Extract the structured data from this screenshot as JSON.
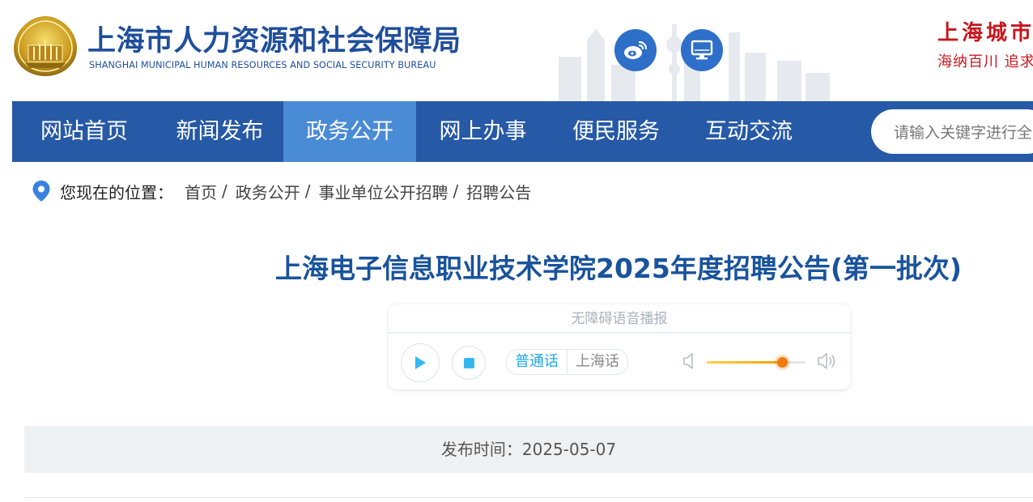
{
  "header": {
    "title": "上海市人力资源和社会保障局",
    "subtitle": "SHANGHAI MUNICIPAL HUMAN RESOURCES AND SOCIAL SECURITY BUREAU",
    "slogan_line1": "上海城市",
    "slogan_line2": "海纳百川 追求",
    "icons": [
      "emblem-logo",
      "weibo-icon",
      "desktop-icon"
    ]
  },
  "nav": {
    "items": [
      {
        "label": "网站首页"
      },
      {
        "label": "新闻发布"
      },
      {
        "label": "政务公开",
        "active": true
      },
      {
        "label": "网上办事"
      },
      {
        "label": "便民服务"
      },
      {
        "label": "互动交流"
      }
    ],
    "search_placeholder": "请输入关键字进行全"
  },
  "breadcrumb": {
    "label": "您现在的位置：",
    "items": [
      "首页",
      "政务公开",
      "事业单位公开招聘",
      "招聘公告"
    ],
    "separator": "/"
  },
  "article": {
    "title": "上海电子信息职业技术学院2025年度招聘公告(第一批次)"
  },
  "audio": {
    "header": "无障碍语音播报",
    "lang_mandarin": "普通话",
    "lang_shanghai": "上海话",
    "active_lang": "普通话",
    "volume_level": 0.76,
    "accent_color": "#1fa8e8",
    "volume_color": "#f07a10"
  },
  "meta": {
    "publish_time": "发布时间：2025-05-07"
  },
  "colors": {
    "nav_bg": "#2659a6",
    "nav_active": "#4a8bd6",
    "title": "#19539c",
    "brand": "#1f4e9c",
    "slogan": "#c8161d"
  }
}
